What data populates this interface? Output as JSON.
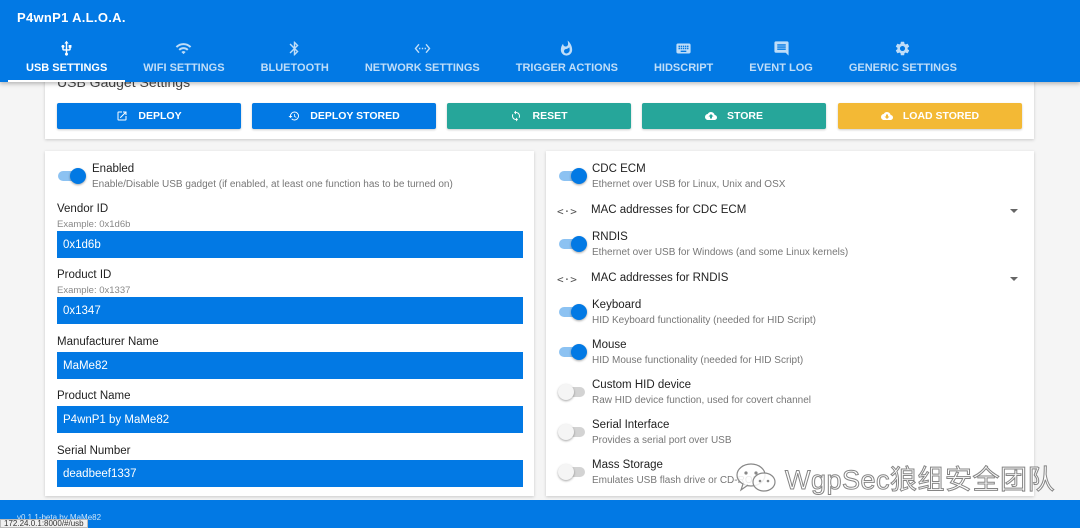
{
  "app": {
    "title": "P4wnP1 A.L.O.A."
  },
  "tabs": [
    {
      "label": "USB SETTINGS",
      "icon": "usb-icon",
      "active": true
    },
    {
      "label": "WIFI SETTINGS",
      "icon": "wifi-icon"
    },
    {
      "label": "BLUETOOTH",
      "icon": "bluetooth-icon"
    },
    {
      "label": "NETWORK SETTINGS",
      "icon": "code-arrows-icon"
    },
    {
      "label": "TRIGGER ACTIONS",
      "icon": "flame-icon"
    },
    {
      "label": "HIDSCRIPT",
      "icon": "keyboard-icon"
    },
    {
      "label": "EVENT LOG",
      "icon": "comment-icon"
    },
    {
      "label": "GENERIC SETTINGS",
      "icon": "gear-icon"
    }
  ],
  "gadget": {
    "title": "USB Gadget Settings",
    "buttons": [
      {
        "label": "DEPLOY",
        "icon": "open-in-new-icon",
        "color": "#0279e4"
      },
      {
        "label": "DEPLOY STORED",
        "icon": "history-icon",
        "color": "#0279e4"
      },
      {
        "label": "RESET",
        "icon": "refresh-icon",
        "color": "#26a69a"
      },
      {
        "label": "STORE",
        "icon": "cloud-upload-icon",
        "color": "#26a69a"
      },
      {
        "label": "LOAD STORED",
        "icon": "cloud-download-icon",
        "color": "#f3b935"
      }
    ]
  },
  "left": {
    "enabled": {
      "title": "Enabled",
      "subtitle": "Enable/Disable USB gadget (if enabled, at least one function has to be turned on)",
      "on": true
    },
    "fields": [
      {
        "label": "Vendor ID",
        "hint": "Example: 0x1d6b",
        "value": "0x1d6b"
      },
      {
        "label": "Product ID",
        "hint": "Example: 0x1337",
        "value": "0x1347"
      },
      {
        "label": "Manufacturer Name",
        "hint": "",
        "value": "MaMe82"
      },
      {
        "label": "Product Name",
        "hint": "",
        "value": "P4wnP1 by MaMe82"
      },
      {
        "label": "Serial Number",
        "hint": "",
        "value": "deadbeef1337"
      }
    ]
  },
  "right": {
    "functions": [
      {
        "title": "CDC ECM",
        "subtitle": "Ethernet over USB for Linux, Unix and OSX",
        "on": true
      },
      {
        "title": "RNDIS",
        "subtitle": "Ethernet over USB for Windows (and some Linux kernels)",
        "on": true
      },
      {
        "title": "Keyboard",
        "subtitle": "HID Keyboard functionality (needed for HID Script)",
        "on": true
      },
      {
        "title": "Mouse",
        "subtitle": "HID Mouse functionality (needed for HID Script)",
        "on": true
      },
      {
        "title": "Custom HID device",
        "subtitle": "Raw HID device function, used for covert channel",
        "on": false
      },
      {
        "title": "Serial Interface",
        "subtitle": "Provides a serial port over USB",
        "on": false
      },
      {
        "title": "Mass Storage",
        "subtitle": "Emulates USB flash drive or CD-ROM",
        "on": false
      }
    ],
    "expanders": [
      {
        "label": "MAC addresses for CDC ECM",
        "icon": "<·>"
      },
      {
        "label": "MAC addresses for RNDIS",
        "icon": "<·>"
      }
    ]
  },
  "footer": {
    "text": "v0.1.1-beta by MaMe82",
    "status_url": "172.24.0.1:8000/#/usb"
  },
  "watermark": {
    "text": "WgpSec狼组安全团队"
  }
}
